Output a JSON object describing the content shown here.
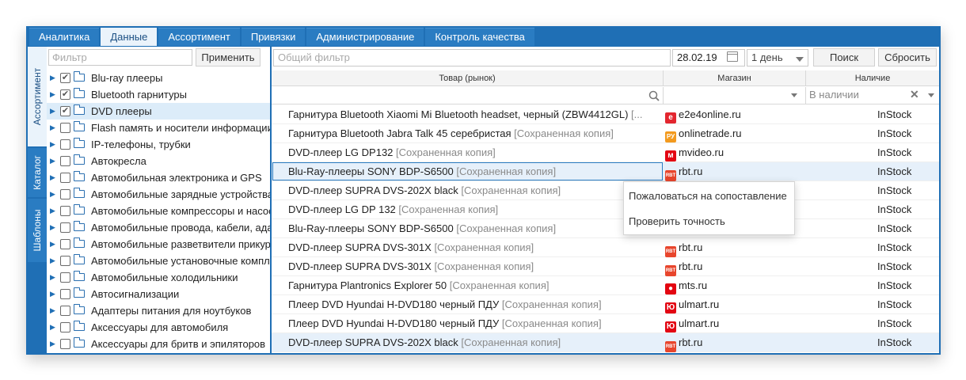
{
  "tabs": [
    "Аналитика",
    "Данные",
    "Ассортимент",
    "Привязки",
    "Администрирование",
    "Контроль качества"
  ],
  "active_tab": "Данные",
  "side_tabs": [
    "Ассортимент",
    "Каталог",
    "Шаблоны"
  ],
  "left": {
    "filter_placeholder": "Фильтр",
    "apply_button": "Применить",
    "tree": [
      {
        "label": "Blu-ray плееры",
        "checked": true
      },
      {
        "label": "Bluetooth гарнитуры",
        "checked": true
      },
      {
        "label": "DVD плееры",
        "checked": true,
        "selected": true
      },
      {
        "label": "Flash память и носители информации",
        "checked": false
      },
      {
        "label": "IP-телефоны, трубки",
        "checked": false
      },
      {
        "label": "Автокресла",
        "checked": false
      },
      {
        "label": "Автомобильная электроника и GPS",
        "checked": false
      },
      {
        "label": "Автомобильные зарядные устройства",
        "checked": false
      },
      {
        "label": "Автомобильные компрессоры и насосы",
        "checked": false
      },
      {
        "label": "Автомобильные провода, кабели, адаптеры",
        "checked": false
      },
      {
        "label": "Автомобильные разветвители прикуривателя",
        "checked": false
      },
      {
        "label": "Автомобильные установочные комплекты",
        "checked": false
      },
      {
        "label": "Автомобильные холодильники",
        "checked": false
      },
      {
        "label": "Автосигнализации",
        "checked": false
      },
      {
        "label": "Адаптеры питания для ноутбуков",
        "checked": false
      },
      {
        "label": "Аксессуары для автомобиля",
        "checked": false
      },
      {
        "label": "Аксессуары для бритв и эпиляторов",
        "checked": false
      }
    ]
  },
  "toolbar": {
    "filter_placeholder": "Общий фильтр",
    "date": "28.02.19",
    "period": "1 день",
    "search_button": "Поиск",
    "reset_button": "Сбросить"
  },
  "columns": {
    "product": "Товар (рынок)",
    "store": "Магазин",
    "availability": "Наличие",
    "availability_filter": "В наличии"
  },
  "saved_copy": "[Сохраненная копия]",
  "rows": [
    {
      "product": "Гарнитура Bluetooth Xiaomi Mi Bluetooth headset, черный (ZBW4412GL)",
      "saved": "[...",
      "store": "e2e4online.ru",
      "icon": "e2e4",
      "avail": "InStock"
    },
    {
      "product": "Гарнитура Bluetooth Jabra Talk 45 серебристая",
      "saved": "[Сохраненная копия]",
      "store": "onlinetrade.ru",
      "icon": "onlinetrade",
      "avail": "InStock"
    },
    {
      "product": "DVD-плеер LG DP132",
      "saved": "[Сохраненная копия]",
      "store": "mvideo.ru",
      "icon": "mvideo",
      "avail": "InStock"
    },
    {
      "product": "Blu-Ray-плееры SONY BDP-S6500",
      "saved": "[Сохраненная копия]",
      "store": "rbt.ru",
      "icon": "rbt",
      "avail": "InStock",
      "selected": true
    },
    {
      "product": "DVD-плеер SUPRA DVS-202X black",
      "saved": "[Сохраненная копия]",
      "store": "",
      "icon": "",
      "avail": "InStock"
    },
    {
      "product": "DVD-плеер LG DP 132",
      "saved": "[Сохраненная копия]",
      "store": "",
      "icon": "",
      "avail": "InStock"
    },
    {
      "product": "Blu-Ray-плееры SONY BDP-S6500",
      "saved": "[Сохраненная копия]",
      "store": "",
      "icon": "",
      "avail": "InStock"
    },
    {
      "product": "DVD-плеер SUPRA DVS-301X",
      "saved": "[Сохраненная копия]",
      "store": "rbt.ru",
      "icon": "rbt",
      "avail": "InStock"
    },
    {
      "product": "DVD-плеер SUPRA DVS-301X",
      "saved": "[Сохраненная копия]",
      "store": "rbt.ru",
      "icon": "rbt",
      "avail": "InStock"
    },
    {
      "product": "Гарнитура Plantronics Explorer 50",
      "saved": "[Сохраненная копия]",
      "store": "mts.ru",
      "icon": "mts",
      "avail": "InStock"
    },
    {
      "product": "Плеер DVD Hyundai H-DVD180 черный ПДУ",
      "saved": "[Сохраненная копия]",
      "store": "ulmart.ru",
      "icon": "ulmart",
      "avail": "InStock"
    },
    {
      "product": "Плеер DVD Hyundai H-DVD180 черный ПДУ",
      "saved": "[Сохраненная копия]",
      "store": "ulmart.ru",
      "icon": "ulmart",
      "avail": "InStock"
    },
    {
      "product": "DVD-плеер SUPRA DVS-202X black",
      "saved": "[Сохраненная копия]",
      "store": "rbt.ru",
      "icon": "rbt",
      "avail": "InStock",
      "selected": true
    }
  ],
  "context_menu": [
    "Пожаловаться на сопоставление",
    "Проверить точность"
  ],
  "icons": {
    "e2e4": {
      "glyph": "e",
      "color": "#e3262f"
    },
    "onlinetrade": {
      "glyph": "РУ",
      "color": "#f39a1e"
    },
    "mvideo": {
      "glyph": "м",
      "color": "#e30613"
    },
    "rbt": {
      "glyph": "RBT",
      "color": "#e8452c"
    },
    "mts": {
      "glyph": "●",
      "color": "#e30611"
    },
    "ulmart": {
      "glyph": "Ю",
      "color": "#e30613"
    }
  },
  "colors": {
    "frame": "#1f6fb5",
    "selected_row": "#e6f0fa"
  }
}
